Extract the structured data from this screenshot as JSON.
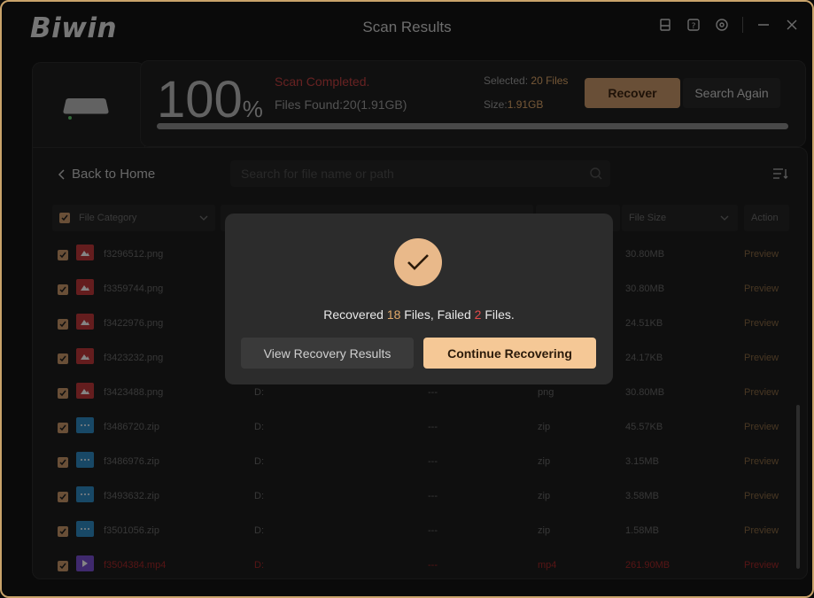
{
  "app": {
    "logo": "Biwin",
    "title": "Scan Results"
  },
  "titlebar_icons": [
    "drive-icon",
    "help-icon",
    "settings-icon",
    "minimize-icon",
    "close-icon"
  ],
  "scan": {
    "percent": "100",
    "percent_sign": "%",
    "status": "Scan Completed.",
    "found_label": "Files Found:",
    "found_value": "20(1.91GB)",
    "selected_label": "Selected:",
    "selected_value": "20 Files",
    "size_label": "Size:",
    "size_value": "1.91GB",
    "progress": 1.0,
    "recover_label": "Recover",
    "search_again_label": "Search Again"
  },
  "toolbar": {
    "back_label": "Back to Home",
    "search_placeholder": "Search for file name or path"
  },
  "table": {
    "headers": {
      "category": "File Category",
      "file_size": "File Size",
      "action": "Action"
    },
    "rows": [
      {
        "name": "f3296512.png",
        "path": "",
        "date": "",
        "type": "",
        "size": "30.80MB",
        "action": "Preview",
        "kind": "png"
      },
      {
        "name": "f3359744.png",
        "path": "",
        "date": "",
        "type": "",
        "size": "30.80MB",
        "action": "Preview",
        "kind": "png"
      },
      {
        "name": "f3422976.png",
        "path": "",
        "date": "",
        "type": "",
        "size": "24.51KB",
        "action": "Preview",
        "kind": "png"
      },
      {
        "name": "f3423232.png",
        "path": "",
        "date": "",
        "type": "",
        "size": "24.17KB",
        "action": "Preview",
        "kind": "png"
      },
      {
        "name": "f3423488.png",
        "path": "D:",
        "date": "---",
        "type": "png",
        "size": "30.80MB",
        "action": "Preview",
        "kind": "png"
      },
      {
        "name": "f3486720.zip",
        "path": "D:",
        "date": "---",
        "type": "zip",
        "size": "45.57KB",
        "action": "Preview",
        "kind": "zip"
      },
      {
        "name": "f3486976.zip",
        "path": "D:",
        "date": "---",
        "type": "zip",
        "size": "3.15MB",
        "action": "Preview",
        "kind": "zip"
      },
      {
        "name": "f3493632.zip",
        "path": "D:",
        "date": "---",
        "type": "zip",
        "size": "3.58MB",
        "action": "Preview",
        "kind": "zip"
      },
      {
        "name": "f3501056.zip",
        "path": "D:",
        "date": "---",
        "type": "zip",
        "size": "1.58MB",
        "action": "Preview",
        "kind": "zip"
      },
      {
        "name": "f3504384.mp4",
        "path": "D:",
        "date": "---",
        "type": "mp4",
        "size": "261.90MB",
        "action": "Preview",
        "kind": "mp4"
      }
    ]
  },
  "dialog": {
    "msg_prefix": "Recovered ",
    "recovered_count": "18",
    "msg_mid": " Files, Failed ",
    "failed_count": "2",
    "msg_suffix": " Files.",
    "view_label": "View Recovery Results",
    "continue_label": "Continue Recovering"
  },
  "colors": {
    "accent": "#c9976a",
    "border": "#c9a36a",
    "error": "#e34a4a",
    "png_icon": "#c0393b",
    "zip_icon": "#2f8bc4",
    "mp4_icon": "#7a4fd1"
  }
}
